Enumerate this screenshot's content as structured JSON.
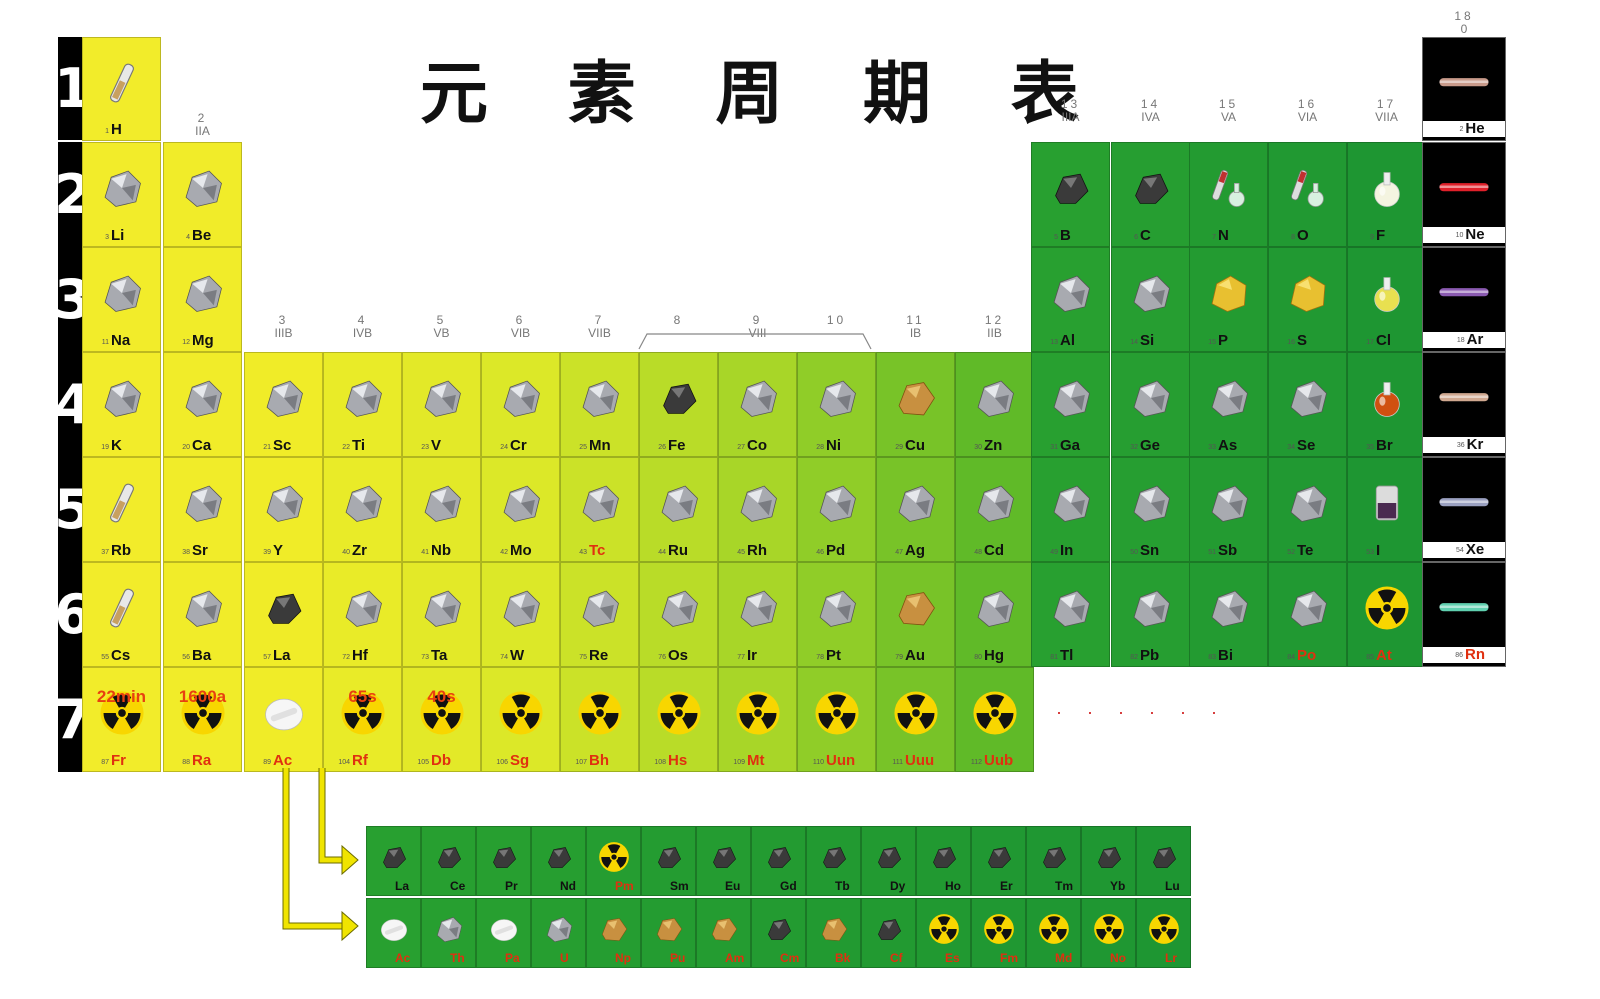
{
  "title": "元 素 周 期 表",
  "period_labels": [
    "1",
    "2",
    "3",
    "4",
    "5",
    "6",
    "7"
  ],
  "group_headers": [
    {
      "g": "2",
      "r": "IIA"
    },
    {
      "g": "3",
      "r": "IIIB"
    },
    {
      "g": "4",
      "r": "IVB"
    },
    {
      "g": "5",
      "r": "VB"
    },
    {
      "g": "6",
      "r": "VIB"
    },
    {
      "g": "7",
      "r": "VIIB"
    },
    {
      "g": "8",
      "r": ""
    },
    {
      "g": "9",
      "r": "VIII"
    },
    {
      "g": "10",
      "r": ""
    },
    {
      "g": "11",
      "r": "IB"
    },
    {
      "g": "12",
      "r": "IIB"
    },
    {
      "g": "13",
      "r": "IIIA"
    },
    {
      "g": "14",
      "r": "IVA"
    },
    {
      "g": "15",
      "r": "VA"
    },
    {
      "g": "16",
      "r": "VIA"
    },
    {
      "g": "17",
      "r": "VIIA"
    },
    {
      "g": "18",
      "r": "0"
    }
  ],
  "more_marker": "· · · · · ·",
  "elements": [
    {
      "n": 1,
      "s": "H",
      "p": 1,
      "c": 1,
      "kind": "vial"
    },
    {
      "n": 2,
      "s": "He",
      "p": 1,
      "c": 18,
      "kind": "glow",
      "glow": "#c89a8a"
    },
    {
      "n": 3,
      "s": "Li",
      "p": 2,
      "c": 1,
      "kind": "metal"
    },
    {
      "n": 4,
      "s": "Be",
      "p": 2,
      "c": 2,
      "kind": "metal"
    },
    {
      "n": 5,
      "s": "B",
      "p": 2,
      "c": 13,
      "kind": "dark"
    },
    {
      "n": 6,
      "s": "C",
      "p": 2,
      "c": 14,
      "kind": "dark"
    },
    {
      "n": 7,
      "s": "N",
      "p": 2,
      "c": 15,
      "kind": "flask"
    },
    {
      "n": 8,
      "s": "O",
      "p": 2,
      "c": 16,
      "kind": "flask"
    },
    {
      "n": 9,
      "s": "F",
      "p": 2,
      "c": 17,
      "kind": "bulb"
    },
    {
      "n": 10,
      "s": "Ne",
      "p": 2,
      "c": 18,
      "kind": "glow",
      "glow": "#e0202a"
    },
    {
      "n": 11,
      "s": "Na",
      "p": 3,
      "c": 1,
      "kind": "metal"
    },
    {
      "n": 12,
      "s": "Mg",
      "p": 3,
      "c": 2,
      "kind": "metal"
    },
    {
      "n": 13,
      "s": "Al",
      "p": 3,
      "c": 13,
      "kind": "metal"
    },
    {
      "n": 14,
      "s": "Si",
      "p": 3,
      "c": 14,
      "kind": "metal"
    },
    {
      "n": 15,
      "s": "P",
      "p": 3,
      "c": 15,
      "kind": "yellow"
    },
    {
      "n": 16,
      "s": "S",
      "p": 3,
      "c": 16,
      "kind": "yellow"
    },
    {
      "n": 17,
      "s": "Cl",
      "p": 3,
      "c": 17,
      "kind": "bulb",
      "tint": "#e8e050"
    },
    {
      "n": 18,
      "s": "Ar",
      "p": 3,
      "c": 18,
      "kind": "glow",
      "glow": "#8a5ab0"
    },
    {
      "n": 19,
      "s": "K",
      "p": 4,
      "c": 1,
      "kind": "metal"
    },
    {
      "n": 20,
      "s": "Ca",
      "p": 4,
      "c": 2,
      "kind": "metal"
    },
    {
      "n": 21,
      "s": "Sc",
      "p": 4,
      "c": 3,
      "kind": "metal"
    },
    {
      "n": 22,
      "s": "Ti",
      "p": 4,
      "c": 4,
      "kind": "metal"
    },
    {
      "n": 23,
      "s": "V",
      "p": 4,
      "c": 5,
      "kind": "metal"
    },
    {
      "n": 24,
      "s": "Cr",
      "p": 4,
      "c": 6,
      "kind": "metal"
    },
    {
      "n": 25,
      "s": "Mn",
      "p": 4,
      "c": 7,
      "kind": "metal"
    },
    {
      "n": 26,
      "s": "Fe",
      "p": 4,
      "c": 8,
      "kind": "dark"
    },
    {
      "n": 27,
      "s": "Co",
      "p": 4,
      "c": 9,
      "kind": "metal"
    },
    {
      "n": 28,
      "s": "Ni",
      "p": 4,
      "c": 10,
      "kind": "metal"
    },
    {
      "n": 29,
      "s": "Cu",
      "p": 4,
      "c": 11,
      "kind": "copper"
    },
    {
      "n": 30,
      "s": "Zn",
      "p": 4,
      "c": 12,
      "kind": "metal"
    },
    {
      "n": 31,
      "s": "Ga",
      "p": 4,
      "c": 13,
      "kind": "metal"
    },
    {
      "n": 32,
      "s": "Ge",
      "p": 4,
      "c": 14,
      "kind": "metal"
    },
    {
      "n": 33,
      "s": "As",
      "p": 4,
      "c": 15,
      "kind": "metal"
    },
    {
      "n": 34,
      "s": "Se",
      "p": 4,
      "c": 16,
      "kind": "metal"
    },
    {
      "n": 35,
      "s": "Br",
      "p": 4,
      "c": 17,
      "kind": "bulb",
      "tint": "#d05010"
    },
    {
      "n": 36,
      "s": "Kr",
      "p": 4,
      "c": 18,
      "kind": "glow",
      "glow": "#d0a890"
    },
    {
      "n": 37,
      "s": "Rb",
      "p": 5,
      "c": 1,
      "kind": "vial"
    },
    {
      "n": 38,
      "s": "Sr",
      "p": 5,
      "c": 2,
      "kind": "metal"
    },
    {
      "n": 39,
      "s": "Y",
      "p": 5,
      "c": 3,
      "kind": "metal"
    },
    {
      "n": 40,
      "s": "Zr",
      "p": 5,
      "c": 4,
      "kind": "metal"
    },
    {
      "n": 41,
      "s": "Nb",
      "p": 5,
      "c": 5,
      "kind": "metal"
    },
    {
      "n": 42,
      "s": "Mo",
      "p": 5,
      "c": 6,
      "kind": "metal"
    },
    {
      "n": 43,
      "s": "Tc",
      "p": 5,
      "c": 7,
      "kind": "metal",
      "red": true
    },
    {
      "n": 44,
      "s": "Ru",
      "p": 5,
      "c": 8,
      "kind": "metal"
    },
    {
      "n": 45,
      "s": "Rh",
      "p": 5,
      "c": 9,
      "kind": "metal"
    },
    {
      "n": 46,
      "s": "Pd",
      "p": 5,
      "c": 10,
      "kind": "metal"
    },
    {
      "n": 47,
      "s": "Ag",
      "p": 5,
      "c": 11,
      "kind": "metal"
    },
    {
      "n": 48,
      "s": "Cd",
      "p": 5,
      "c": 12,
      "kind": "metal"
    },
    {
      "n": 49,
      "s": "In",
      "p": 5,
      "c": 13,
      "kind": "metal"
    },
    {
      "n": 50,
      "s": "Sn",
      "p": 5,
      "c": 14,
      "kind": "metal"
    },
    {
      "n": 51,
      "s": "Sb",
      "p": 5,
      "c": 15,
      "kind": "metal"
    },
    {
      "n": 52,
      "s": "Te",
      "p": 5,
      "c": 16,
      "kind": "metal"
    },
    {
      "n": 53,
      "s": "I",
      "p": 5,
      "c": 17,
      "kind": "jar"
    },
    {
      "n": 54,
      "s": "Xe",
      "p": 5,
      "c": 18,
      "kind": "glow",
      "glow": "#9aa0c0"
    },
    {
      "n": 55,
      "s": "Cs",
      "p": 6,
      "c": 1,
      "kind": "vial"
    },
    {
      "n": 56,
      "s": "Ba",
      "p": 6,
      "c": 2,
      "kind": "metal"
    },
    {
      "n": 57,
      "s": "La",
      "p": 6,
      "c": 3,
      "kind": "dark"
    },
    {
      "n": 72,
      "s": "Hf",
      "p": 6,
      "c": 4,
      "kind": "metal"
    },
    {
      "n": 73,
      "s": "Ta",
      "p": 6,
      "c": 5,
      "kind": "metal"
    },
    {
      "n": 74,
      "s": "W",
      "p": 6,
      "c": 6,
      "kind": "metal"
    },
    {
      "n": 75,
      "s": "Re",
      "p": 6,
      "c": 7,
      "kind": "metal"
    },
    {
      "n": 76,
      "s": "Os",
      "p": 6,
      "c": 8,
      "kind": "metal"
    },
    {
      "n": 77,
      "s": "Ir",
      "p": 6,
      "c": 9,
      "kind": "metal"
    },
    {
      "n": 78,
      "s": "Pt",
      "p": 6,
      "c": 10,
      "kind": "metal"
    },
    {
      "n": 79,
      "s": "Au",
      "p": 6,
      "c": 11,
      "kind": "copper"
    },
    {
      "n": 80,
      "s": "Hg",
      "p": 6,
      "c": 12,
      "kind": "metal"
    },
    {
      "n": 81,
      "s": "Tl",
      "p": 6,
      "c": 13,
      "kind": "metal"
    },
    {
      "n": 82,
      "s": "Pb",
      "p": 6,
      "c": 14,
      "kind": "metal"
    },
    {
      "n": 83,
      "s": "Bi",
      "p": 6,
      "c": 15,
      "kind": "metal"
    },
    {
      "n": 84,
      "s": "Po",
      "p": 6,
      "c": 16,
      "kind": "metal",
      "red": true
    },
    {
      "n": 85,
      "s": "At",
      "p": 6,
      "c": 17,
      "kind": "rad",
      "red": true
    },
    {
      "n": 86,
      "s": "Rn",
      "p": 6,
      "c": 18,
      "kind": "glow",
      "glow": "#60d0b0",
      "red": true
    },
    {
      "n": 87,
      "s": "Fr",
      "p": 7,
      "c": 1,
      "kind": "rad",
      "red": true,
      "hl": "22min"
    },
    {
      "n": 88,
      "s": "Ra",
      "p": 7,
      "c": 2,
      "kind": "rad",
      "red": true,
      "hl": "1600a"
    },
    {
      "n": 89,
      "s": "Ac",
      "p": 7,
      "c": 3,
      "kind": "white",
      "red": true
    },
    {
      "n": 104,
      "s": "Rf",
      "p": 7,
      "c": 4,
      "kind": "rad",
      "red": true,
      "hl": "65s"
    },
    {
      "n": 105,
      "s": "Db",
      "p": 7,
      "c": 5,
      "kind": "rad",
      "red": true,
      "hl": "40s"
    },
    {
      "n": 106,
      "s": "Sg",
      "p": 7,
      "c": 6,
      "kind": "rad",
      "red": true
    },
    {
      "n": 107,
      "s": "Bh",
      "p": 7,
      "c": 7,
      "kind": "rad",
      "red": true
    },
    {
      "n": 108,
      "s": "Hs",
      "p": 7,
      "c": 8,
      "kind": "rad",
      "red": true
    },
    {
      "n": 109,
      "s": "Mt",
      "p": 7,
      "c": 9,
      "kind": "rad",
      "red": true
    },
    {
      "n": 110,
      "s": "Uun",
      "p": 7,
      "c": 10,
      "kind": "rad",
      "red": true
    },
    {
      "n": 111,
      "s": "Uuu",
      "p": 7,
      "c": 11,
      "kind": "rad",
      "red": true
    },
    {
      "n": 112,
      "s": "Uub",
      "p": 7,
      "c": 12,
      "kind": "rad",
      "red": true
    }
  ],
  "lanthanides": [
    {
      "s": "La",
      "kind": "dark"
    },
    {
      "s": "Ce",
      "kind": "dark"
    },
    {
      "s": "Pr",
      "kind": "dark"
    },
    {
      "s": "Nd",
      "kind": "dark"
    },
    {
      "s": "Pm",
      "kind": "rad",
      "red": true
    },
    {
      "s": "Sm",
      "kind": "dark"
    },
    {
      "s": "Eu",
      "kind": "dark"
    },
    {
      "s": "Gd",
      "kind": "dark"
    },
    {
      "s": "Tb",
      "kind": "dark"
    },
    {
      "s": "Dy",
      "kind": "dark"
    },
    {
      "s": "Ho",
      "kind": "dark"
    },
    {
      "s": "Er",
      "kind": "dark"
    },
    {
      "s": "Tm",
      "kind": "dark"
    },
    {
      "s": "Yb",
      "kind": "dark"
    },
    {
      "s": "Lu",
      "kind": "dark"
    }
  ],
  "actinides": [
    {
      "s": "Ac",
      "kind": "white",
      "red": true
    },
    {
      "s": "Th",
      "kind": "metal",
      "red": true
    },
    {
      "s": "Pa",
      "kind": "white",
      "red": true
    },
    {
      "s": "U",
      "kind": "metal",
      "red": true
    },
    {
      "s": "Np",
      "kind": "copper",
      "red": true
    },
    {
      "s": "Pu",
      "kind": "copper",
      "red": true
    },
    {
      "s": "Am",
      "kind": "copper",
      "red": true
    },
    {
      "s": "Cm",
      "kind": "dark",
      "red": true
    },
    {
      "s": "Bk",
      "kind": "copper",
      "red": true
    },
    {
      "s": "Cf",
      "kind": "dark",
      "red": true
    },
    {
      "s": "Es",
      "kind": "rad",
      "red": true
    },
    {
      "s": "Fm",
      "kind": "rad",
      "red": true
    },
    {
      "s": "Md",
      "kind": "rad",
      "red": true
    },
    {
      "s": "No",
      "kind": "rad",
      "red": true
    },
    {
      "s": "Lr",
      "kind": "rad",
      "red": true
    }
  ],
  "colors": {
    "yellow": "#f2ec2a",
    "green_dark": "#1f9a32",
    "noble_bg": "#000000",
    "symbol_red": "#e03010",
    "rad_yellow": "#f8d600"
  }
}
